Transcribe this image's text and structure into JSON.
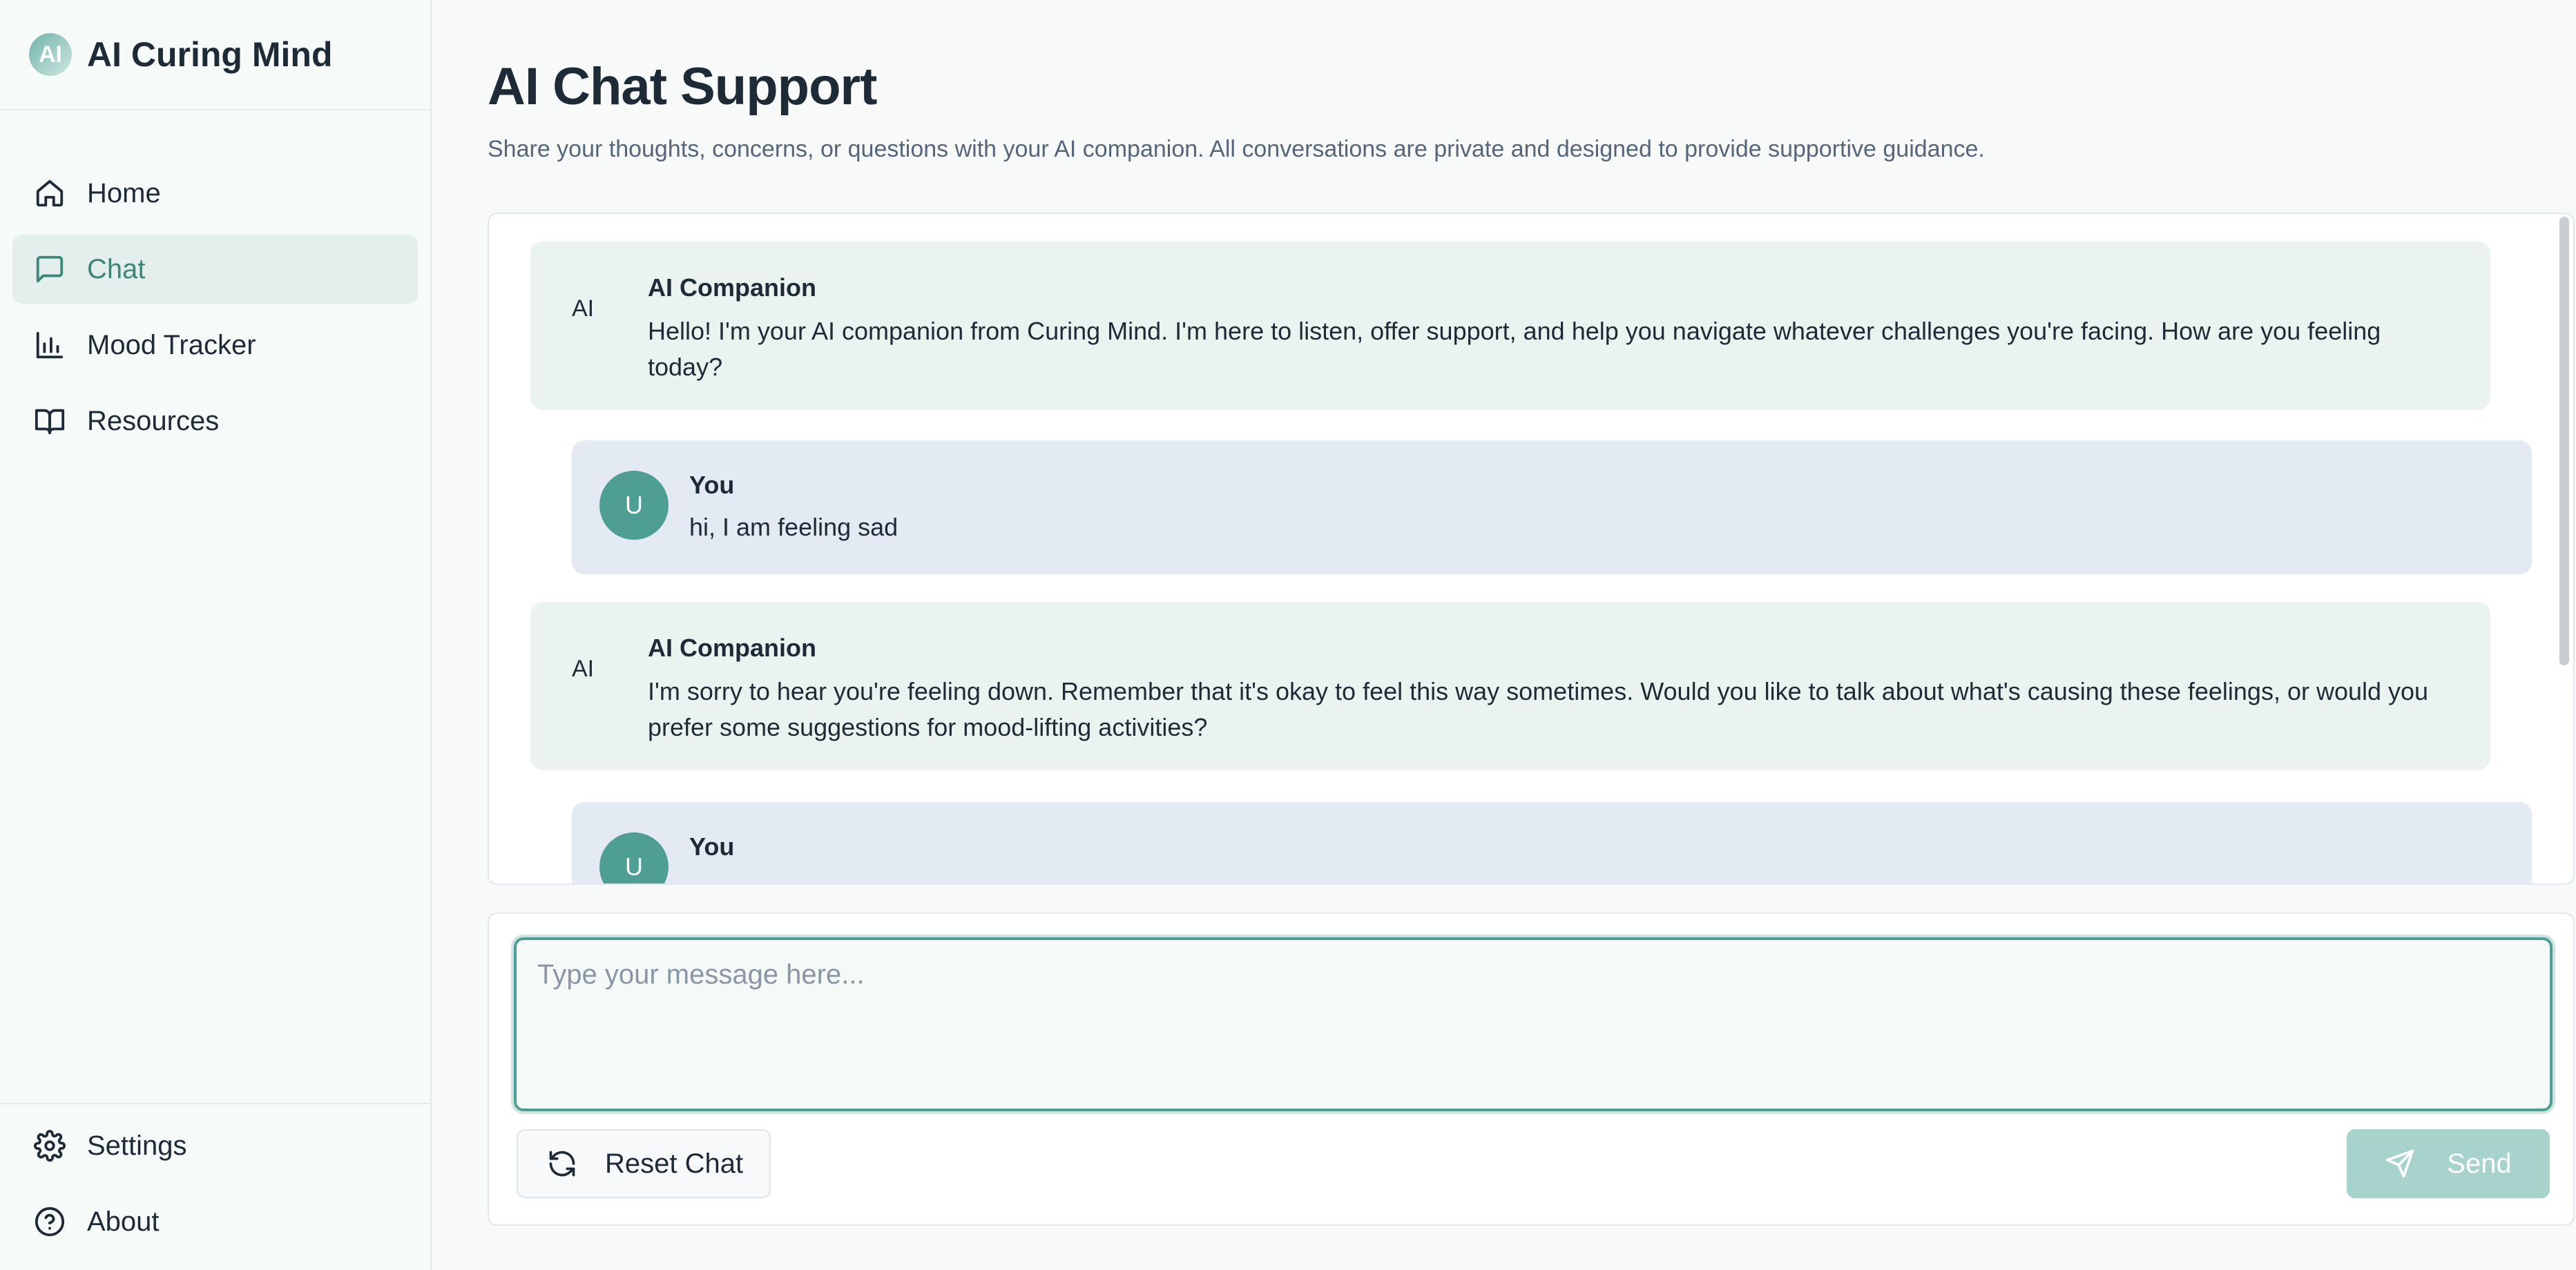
{
  "brand": {
    "logo_text": "AI",
    "name": "AI Curing Mind"
  },
  "nav": {
    "items": [
      {
        "label": "Home",
        "icon": "home-icon"
      },
      {
        "label": "Chat",
        "icon": "chat-icon",
        "active": true
      },
      {
        "label": "Mood Tracker",
        "icon": "bar-chart-icon"
      },
      {
        "label": "Resources",
        "icon": "book-icon"
      }
    ],
    "bottom": [
      {
        "label": "Settings",
        "icon": "gear-icon"
      },
      {
        "label": "About",
        "icon": "help-circle-icon"
      }
    ]
  },
  "page": {
    "title": "AI Chat Support",
    "subtitle": "Share your thoughts, concerns, or questions with your AI companion. All conversations are private and designed to provide supportive guidance."
  },
  "messages": [
    {
      "role": "ai",
      "avatar": "AI",
      "sender": "AI Companion",
      "text": "Hello! I'm your AI companion from Curing Mind. I'm here to listen, offer support, and help you navigate whatever challenges you're facing. How are you feeling today?"
    },
    {
      "role": "user",
      "avatar": "U",
      "sender": "You",
      "text": "hi, I am feeling sad"
    },
    {
      "role": "ai",
      "avatar": "AI",
      "sender": "AI Companion",
      "text": "I'm sorry to hear you're feeling down. Remember that it's okay to feel this way sometimes. Would you like to talk about what's causing these feelings, or would you prefer some suggestions for mood-lifting activities?"
    },
    {
      "role": "user",
      "avatar": "U",
      "sender": "You",
      "text": ""
    }
  ],
  "composer": {
    "placeholder": "Type your message here...",
    "value": "",
    "reset_label": "Reset Chat",
    "send_label": "Send"
  },
  "colors": {
    "accent": "#4e9e94",
    "active_nav_bg": "#e3eeed",
    "ai_bubble": "#ebf3f1",
    "user_bubble": "#e3eaf4",
    "send_disabled": "#a8d3cd"
  }
}
